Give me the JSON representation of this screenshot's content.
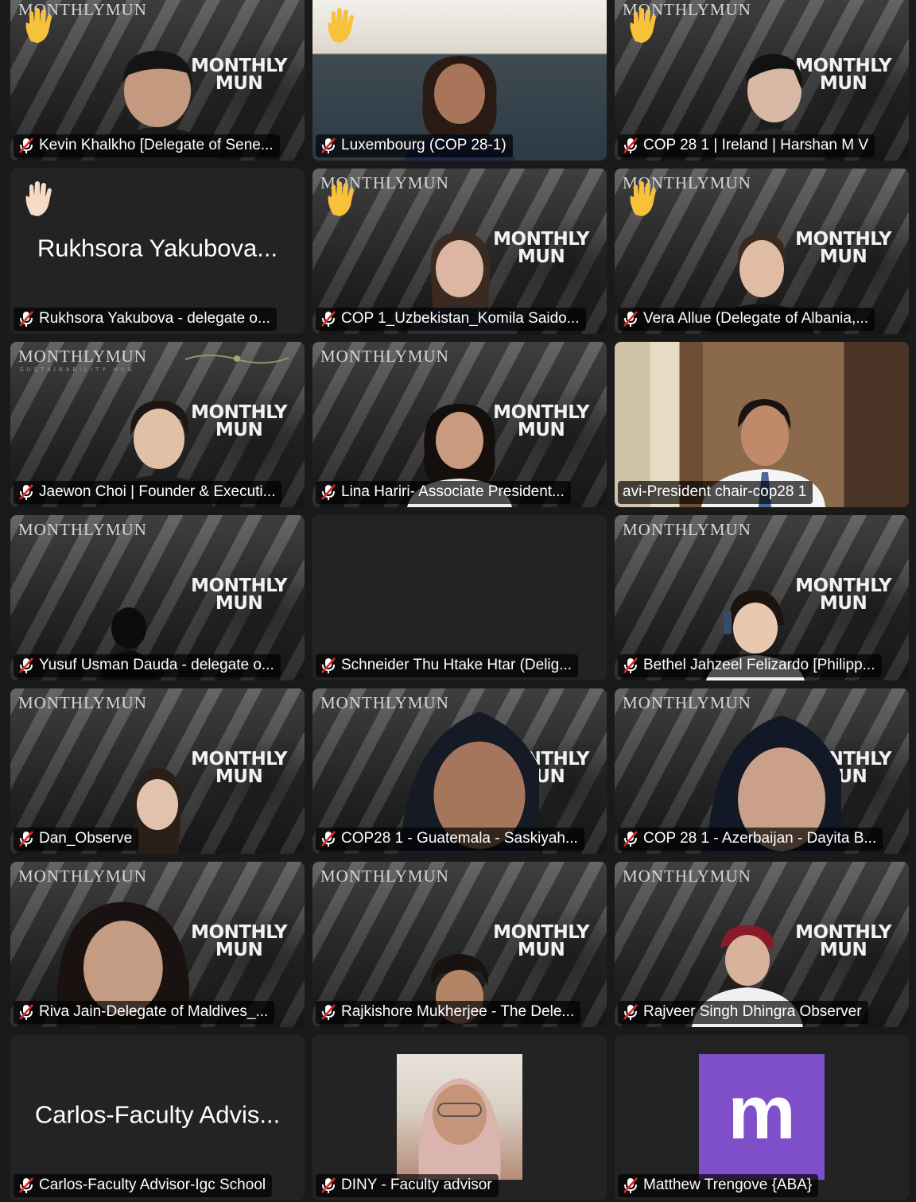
{
  "brand": {
    "wordmark": "MONTHLYMUN",
    "sub": "SUSTAINABILITY HUB",
    "logo_line1": "MONTHLY",
    "logo_line2": "MUN"
  },
  "tiles": [
    {
      "name": "Kevin Khalkho [Delegate of Sene...",
      "hand": true
    },
    {
      "name": "Luxembourg (COP 28-1)",
      "hand": true
    },
    {
      "name": "COP 28 1 | Ireland | Harshan M V",
      "hand": true
    },
    {
      "name": "Rukhsora Yakubova - delegate o...",
      "hand": true,
      "display_name": "Rukhsora Yakubova..."
    },
    {
      "name": "COP 1_Uzbekistan_Komila Saido...",
      "hand": true
    },
    {
      "name": "Vera Allue (Delegate of Albania,...",
      "hand": true
    },
    {
      "name": "Jaewon Choi | Founder & Executi...",
      "hand": false
    },
    {
      "name": "Lina Hariri- Associate President...",
      "hand": false
    },
    {
      "name": "avi-President chair-cop28 1",
      "hand": false,
      "muted": false
    },
    {
      "name": "Yusuf Usman Dauda - delegate o...",
      "hand": false
    },
    {
      "name": "Schneider Thu Htake Htar (Delig...",
      "hand": false
    },
    {
      "name": "Bethel Jahzeel Felizardo [Philipp...",
      "hand": false
    },
    {
      "name": "Dan_Observe",
      "hand": false
    },
    {
      "name": "COP28 1 - Guatemala - Saskiyah...",
      "hand": false
    },
    {
      "name": "COP 28 1 - Azerbaijan - Dayita B...",
      "hand": false
    },
    {
      "name": "Riva Jain-Delegate of Maldives_...",
      "hand": false
    },
    {
      "name": "Rajkishore Mukherjee - The Dele...",
      "hand": false
    },
    {
      "name": "Rajveer Singh Dhingra Observer",
      "hand": false
    },
    {
      "name": "Carlos-Faculty Advisor-Igc School",
      "hand": false,
      "display_name": "Carlos-Faculty Advis..."
    },
    {
      "name": "DINY - Faculty advisor",
      "hand": false
    },
    {
      "name": "Matthew Trengove {ABA}",
      "hand": false,
      "avatar_letter": "m"
    }
  ],
  "colors": {
    "background": "#1a1a1a",
    "tile": "#242424",
    "muted_icon": "#e02828",
    "avatar_purple": "#7f4fc9"
  },
  "icons": {
    "muted": "mic-muted-icon",
    "raised_hand": "raised-hand-icon"
  }
}
